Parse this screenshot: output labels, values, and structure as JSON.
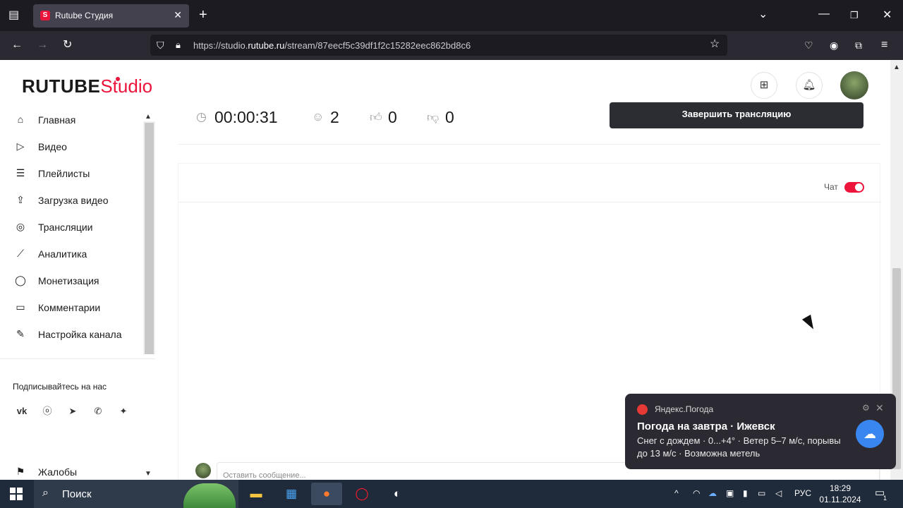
{
  "browser": {
    "tab_title": "Rutube Студия",
    "tab_favicon_letter": "S",
    "url_prefix": "https://studio.",
    "url_domain": "rutube.ru",
    "url_path": "/stream/87eecf5c39df1f2c15282eec862bd8c6"
  },
  "header": {
    "logo_main": "RUTUBE",
    "logo_studio": "Studio"
  },
  "sidebar": {
    "items": [
      {
        "label": "Главная",
        "icon": "home-icon"
      },
      {
        "label": "Видео",
        "icon": "video-icon"
      },
      {
        "label": "Плейлисты",
        "icon": "playlist-icon"
      },
      {
        "label": "Загрузка видео",
        "icon": "upload-icon"
      },
      {
        "label": "Трансляции",
        "icon": "broadcast-icon"
      },
      {
        "label": "Аналитика",
        "icon": "analytics-icon"
      },
      {
        "label": "Монетизация",
        "icon": "coin-icon"
      },
      {
        "label": "Комментарии",
        "icon": "comments-icon"
      },
      {
        "label": "Настройка канала",
        "icon": "wand-icon"
      }
    ],
    "subscribe_label": "Подписывайтесь на нас",
    "socials": [
      "vk-icon",
      "ok-icon",
      "telegram-icon",
      "viber-icon",
      "zen-icon"
    ],
    "bottom_item": "Жалобы"
  },
  "stream": {
    "duration": "00:00:31",
    "viewers": "2",
    "likes": "0",
    "dislikes": "0",
    "end_button": "Завершить трансляцию"
  },
  "chat": {
    "label": "Чат",
    "toggle_on": true,
    "input_placeholder": "Оставить сообщение..."
  },
  "notification": {
    "app": "Яндекс.Погода",
    "title": "Погода на завтра · Ижевск",
    "body": "Снег с дождем · 0...+4° · Ветер 5–7 м/с, порывы до 13 м/с · Возможна метель"
  },
  "taskbar": {
    "search_label": "Поиск",
    "lang": "РУС",
    "time": "18:29",
    "date": "01.11.2024",
    "notif_count": "1"
  },
  "colors": {
    "accent": "#ed143b",
    "taskbar": "#1f2a3a",
    "browser_dark": "#1c1b22"
  }
}
